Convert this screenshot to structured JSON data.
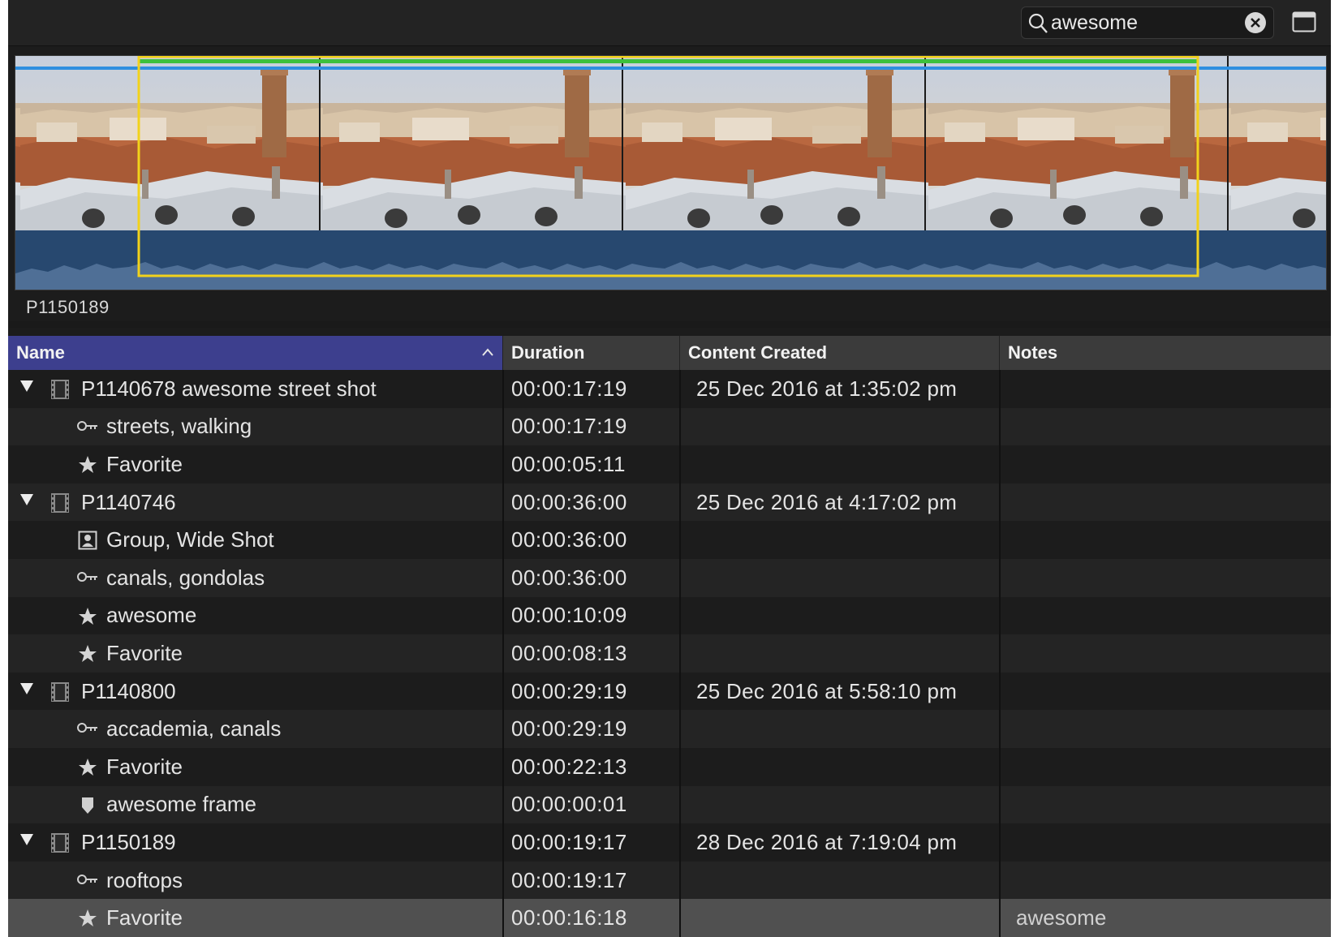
{
  "search": {
    "value": "awesome"
  },
  "filmstrip": {
    "clip_name": "P1150189"
  },
  "columns": {
    "name": "Name",
    "duration": "Duration",
    "created": "Content Created",
    "notes": "Notes"
  },
  "rows": [
    {
      "type": "clip",
      "icon": "film-icon",
      "name": "P1140678 awesome street shot",
      "duration": "00:00:17:19",
      "created": "25 Dec 2016 at 1:35:02 pm",
      "notes": ""
    },
    {
      "type": "sub",
      "icon": "keyword-icon",
      "name": "streets, walking",
      "duration": "00:00:17:19",
      "created": "",
      "notes": ""
    },
    {
      "type": "sub",
      "icon": "star-icon",
      "name": "Favorite",
      "duration": "00:00:05:11",
      "created": "",
      "notes": ""
    },
    {
      "type": "clip",
      "icon": "film-icon",
      "name": "P1140746",
      "duration": "00:00:36:00",
      "created": "25 Dec 2016 at 4:17:02 pm",
      "notes": ""
    },
    {
      "type": "sub",
      "icon": "people-icon",
      "name": "Group, Wide Shot",
      "duration": "00:00:36:00",
      "created": "",
      "notes": ""
    },
    {
      "type": "sub",
      "icon": "keyword-icon",
      "name": "canals, gondolas",
      "duration": "00:00:36:00",
      "created": "",
      "notes": ""
    },
    {
      "type": "sub",
      "icon": "star-icon",
      "name": "awesome",
      "duration": "00:00:10:09",
      "created": "",
      "notes": ""
    },
    {
      "type": "sub",
      "icon": "star-icon",
      "name": "Favorite",
      "duration": "00:00:08:13",
      "created": "",
      "notes": ""
    },
    {
      "type": "clip",
      "icon": "film-icon",
      "name": "P1140800",
      "duration": "00:00:29:19",
      "created": "25 Dec 2016 at 5:58:10 pm",
      "notes": ""
    },
    {
      "type": "sub",
      "icon": "keyword-icon",
      "name": "accademia, canals",
      "duration": "00:00:29:19",
      "created": "",
      "notes": ""
    },
    {
      "type": "sub",
      "icon": "star-icon",
      "name": "Favorite",
      "duration": "00:00:22:13",
      "created": "",
      "notes": ""
    },
    {
      "type": "sub",
      "icon": "marker-icon",
      "name": "awesome frame",
      "duration": "00:00:00:01",
      "created": "",
      "notes": ""
    },
    {
      "type": "clip",
      "icon": "film-icon",
      "name": "P1150189",
      "duration": "00:00:19:17",
      "created": "28 Dec 2016 at 7:19:04 pm",
      "notes": ""
    },
    {
      "type": "sub",
      "icon": "keyword-icon",
      "name": "rooftops",
      "duration": "00:00:19:17",
      "created": "",
      "notes": ""
    },
    {
      "type": "sub",
      "icon": "star-icon",
      "name": "Favorite",
      "duration": "00:00:16:18",
      "created": "",
      "notes": "awesome",
      "selected": true
    }
  ],
  "colors": {
    "accent": "#3d3f8e",
    "selection": "#f2d21b",
    "favorite_bar": "#3cc13c",
    "keyword_bar": "#2e8fe0",
    "audio": "#27486f"
  }
}
